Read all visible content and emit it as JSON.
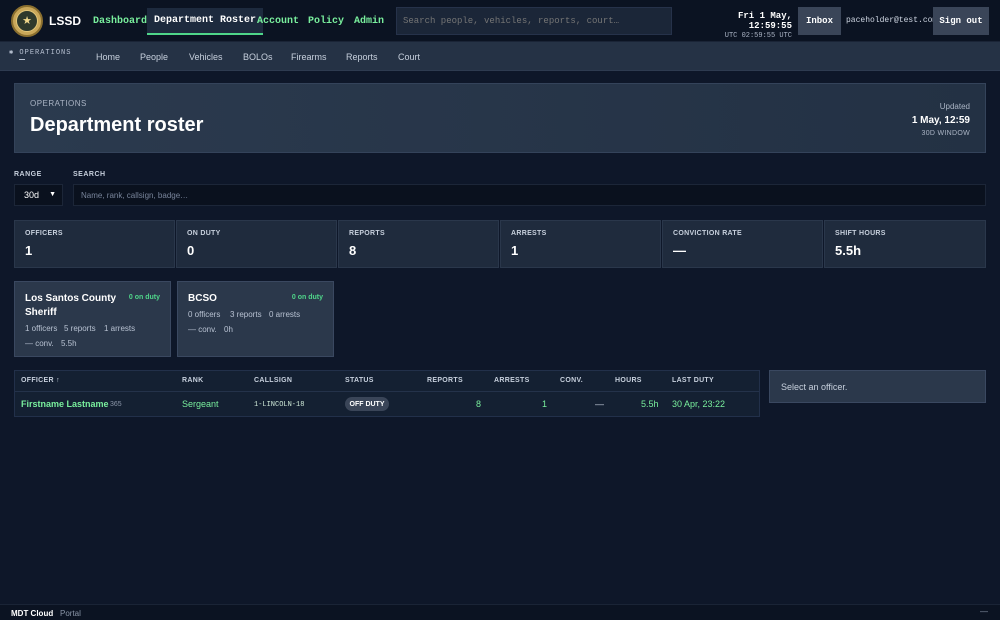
{
  "header": {
    "brand": "LSSD",
    "nav": [
      "Dashboard",
      "Department Roster",
      "Account",
      "Policy",
      "Admin"
    ],
    "search_placeholder": "Search people, vehicles, reports, court…",
    "clock_local": "Fri 1 May, 12:59:55",
    "clock_utc": "UTC 02:59:55 UTC",
    "inbox": "Inbox",
    "email": "paceholder@test.com",
    "signout": "Sign out"
  },
  "subnav": {
    "section": "OPERATIONS",
    "items": [
      "Home",
      "People",
      "Vehicles",
      "BOLOs",
      "Firearms",
      "Reports",
      "Court"
    ]
  },
  "page": {
    "kicker": "OPERATIONS",
    "title": "Department roster",
    "updated_label": "Updated",
    "updated_value": "1 May, 12:59",
    "window": "30D WINDOW"
  },
  "filters": {
    "range_label": "RANGE",
    "range_value": "30d",
    "search_label": "SEARCH",
    "search_placeholder": "Name, rank, callsign, badge…"
  },
  "stats": [
    {
      "label": "OFFICERS",
      "value": "1"
    },
    {
      "label": "ON DUTY",
      "value": "0"
    },
    {
      "label": "REPORTS",
      "value": "8"
    },
    {
      "label": "ARRESTS",
      "value": "1"
    },
    {
      "label": "CONVICTION RATE",
      "value": "—"
    },
    {
      "label": "SHIFT HOURS",
      "value": "5.5h"
    }
  ],
  "departments": [
    {
      "name": "Los Santos County Sheriff",
      "onduty": "0 on duty",
      "officers": "1 officers",
      "reports": "5 reports",
      "arrests": "1 arrests",
      "conv": "— conv.",
      "hours": "5.5h"
    },
    {
      "name": "BCSO",
      "onduty": "0 on duty",
      "officers": "0 officers",
      "reports": "3 reports",
      "arrests": "0 arrests",
      "conv": "— conv.",
      "hours": "0h"
    }
  ],
  "table": {
    "columns": [
      "OFFICER ↑",
      "RANK",
      "CALLSIGN",
      "STATUS",
      "REPORTS",
      "ARRESTS",
      "CONV.",
      "HOURS",
      "LAST DUTY"
    ],
    "rows": [
      {
        "name": "Firstname Lastname",
        "badge": "365",
        "rank": "Sergeant",
        "callsign": "1-LINCOLN-18",
        "status": "OFF DUTY",
        "reports": "8",
        "arrests": "1",
        "conv": "—",
        "hours": "5.5h",
        "last": "30 Apr, 23:22"
      }
    ]
  },
  "detail_placeholder": "Select an officer.",
  "footer": {
    "brand": "MDT Cloud",
    "portal": "Portal",
    "min": "—"
  },
  "colors": {
    "accent": "#4fd68a",
    "bg": "#0e1729"
  }
}
